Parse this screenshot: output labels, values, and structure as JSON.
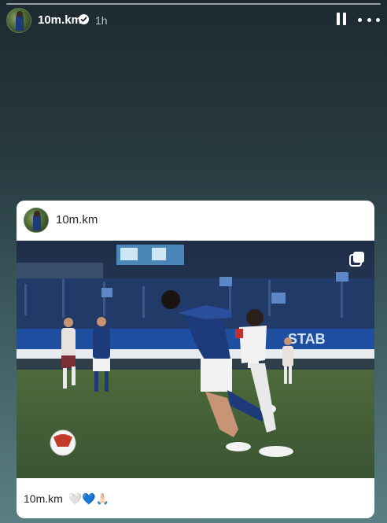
{
  "story": {
    "username": "10m.km",
    "time": "1h",
    "verified": true
  },
  "controls": {
    "pause_icon": "pause-icon",
    "more_icon": "more-options-icon"
  },
  "shared_post": {
    "username": "10m.km",
    "image_description_icon": "multiple-photos-icon",
    "caption_user": "10m.km",
    "caption_emojis": "🤍💙🙏🏻"
  },
  "photo_text": {
    "banner": "STAB"
  },
  "colors": {
    "brand_blue": "#1d3a7a",
    "pitch": "#3c5d3a"
  }
}
